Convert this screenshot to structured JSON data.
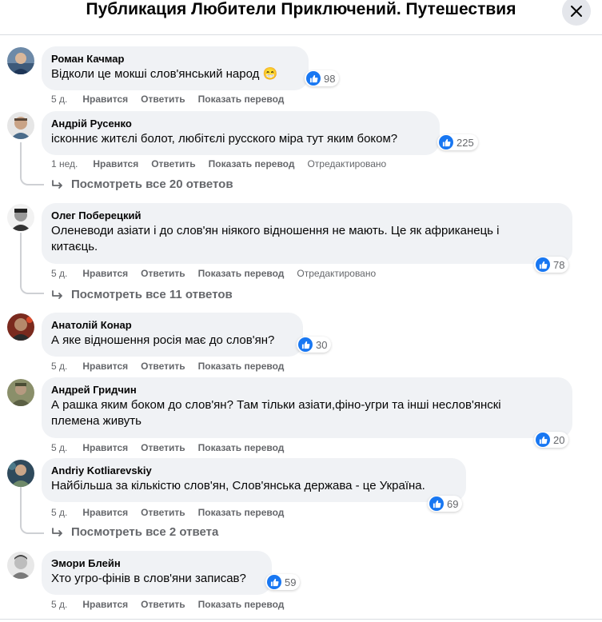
{
  "header": {
    "title": "Публикация Любители Приключений. Путешествия",
    "close_icon": "close-icon"
  },
  "actions": {
    "like": "Нравится",
    "reply": "Ответить",
    "translate": "Показать перевод"
  },
  "comments": [
    {
      "author": "Роман Качмар",
      "text": "Відколи це мокші слов'янський народ 😁",
      "likes": "98",
      "time": "5 д.",
      "edited": ""
    },
    {
      "author": "Андрій Русенко",
      "text": "ісконниє житєлі болот, любітєлі русского міра тут яким боком?",
      "likes": "225",
      "time": "1 нед.",
      "edited": "Отредактировано",
      "replies": "Посмотреть все 20 ответов"
    },
    {
      "author": "Олег Поберецкий",
      "text_line1": "Оленеводи азіати і до слов'ян ніякого відношення не мають. Це як африканець і",
      "text_line2": "китаєць.",
      "likes": "78",
      "time": "5 д.",
      "edited": "Отредактировано",
      "replies": "Посмотреть все 11 ответов"
    },
    {
      "author": "Анатолій Конар",
      "text": "А яке відношення росія має до слов'ян?",
      "likes": "30",
      "time": "5 д.",
      "edited": ""
    },
    {
      "author": "Андрей Гридчин",
      "text_line1": "А рашка яким боком до слов'ян? Там тільки азіати,фіно-угри та інші неслов'янскі",
      "text_line2": "племена живуть",
      "likes": "20",
      "time": "5 д.",
      "edited": ""
    },
    {
      "author": "Andriy Kotliarevskiy",
      "text": "Найбільша за кількістю слов'ян, Слов'янська держава - це Україна.",
      "likes": "69",
      "time": "5 д.",
      "edited": "",
      "replies": "Посмотреть все 2 ответа"
    },
    {
      "author": "Эмори Блейн",
      "text": "Хто угро-фінів в слов'яни записав?",
      "likes": "59",
      "time": "5 д.",
      "edited": ""
    }
  ],
  "colors": {
    "like_blue": "#1877f2",
    "bubble_bg": "#f0f2f5",
    "meta_gray": "#65676b"
  }
}
